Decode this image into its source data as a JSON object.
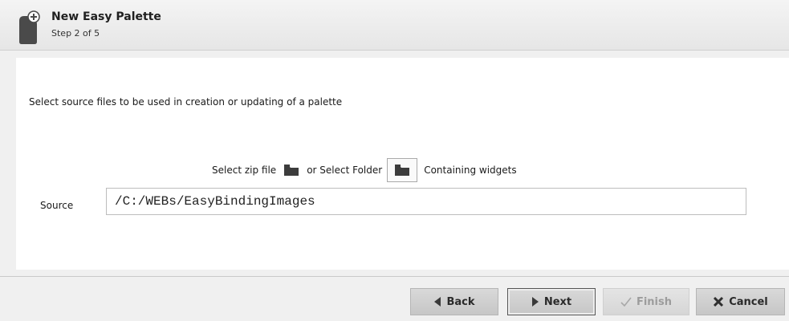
{
  "header": {
    "title": "New Easy Palette",
    "step": "Step 2 of 5",
    "icon": "palette-add-icon"
  },
  "main": {
    "instruction": "Select source files to be used in creation or updating of a palette",
    "select_zip_label": "Select zip file",
    "or_select_folder_label": "or Select Folder",
    "containing_widgets_label": "Containing widgets",
    "source_label": "Source",
    "source_value": "/C:/WEBs/EasyBindingImages"
  },
  "footer": {
    "back_label": "Back",
    "next_label": "Next",
    "finish_label": "Finish",
    "cancel_label": "Cancel"
  },
  "colors": {
    "header_bg": "#e8e8e8",
    "content_bg": "#ffffff",
    "button_bg": "#cfcfcf",
    "disabled_text": "#9c9c9c"
  }
}
